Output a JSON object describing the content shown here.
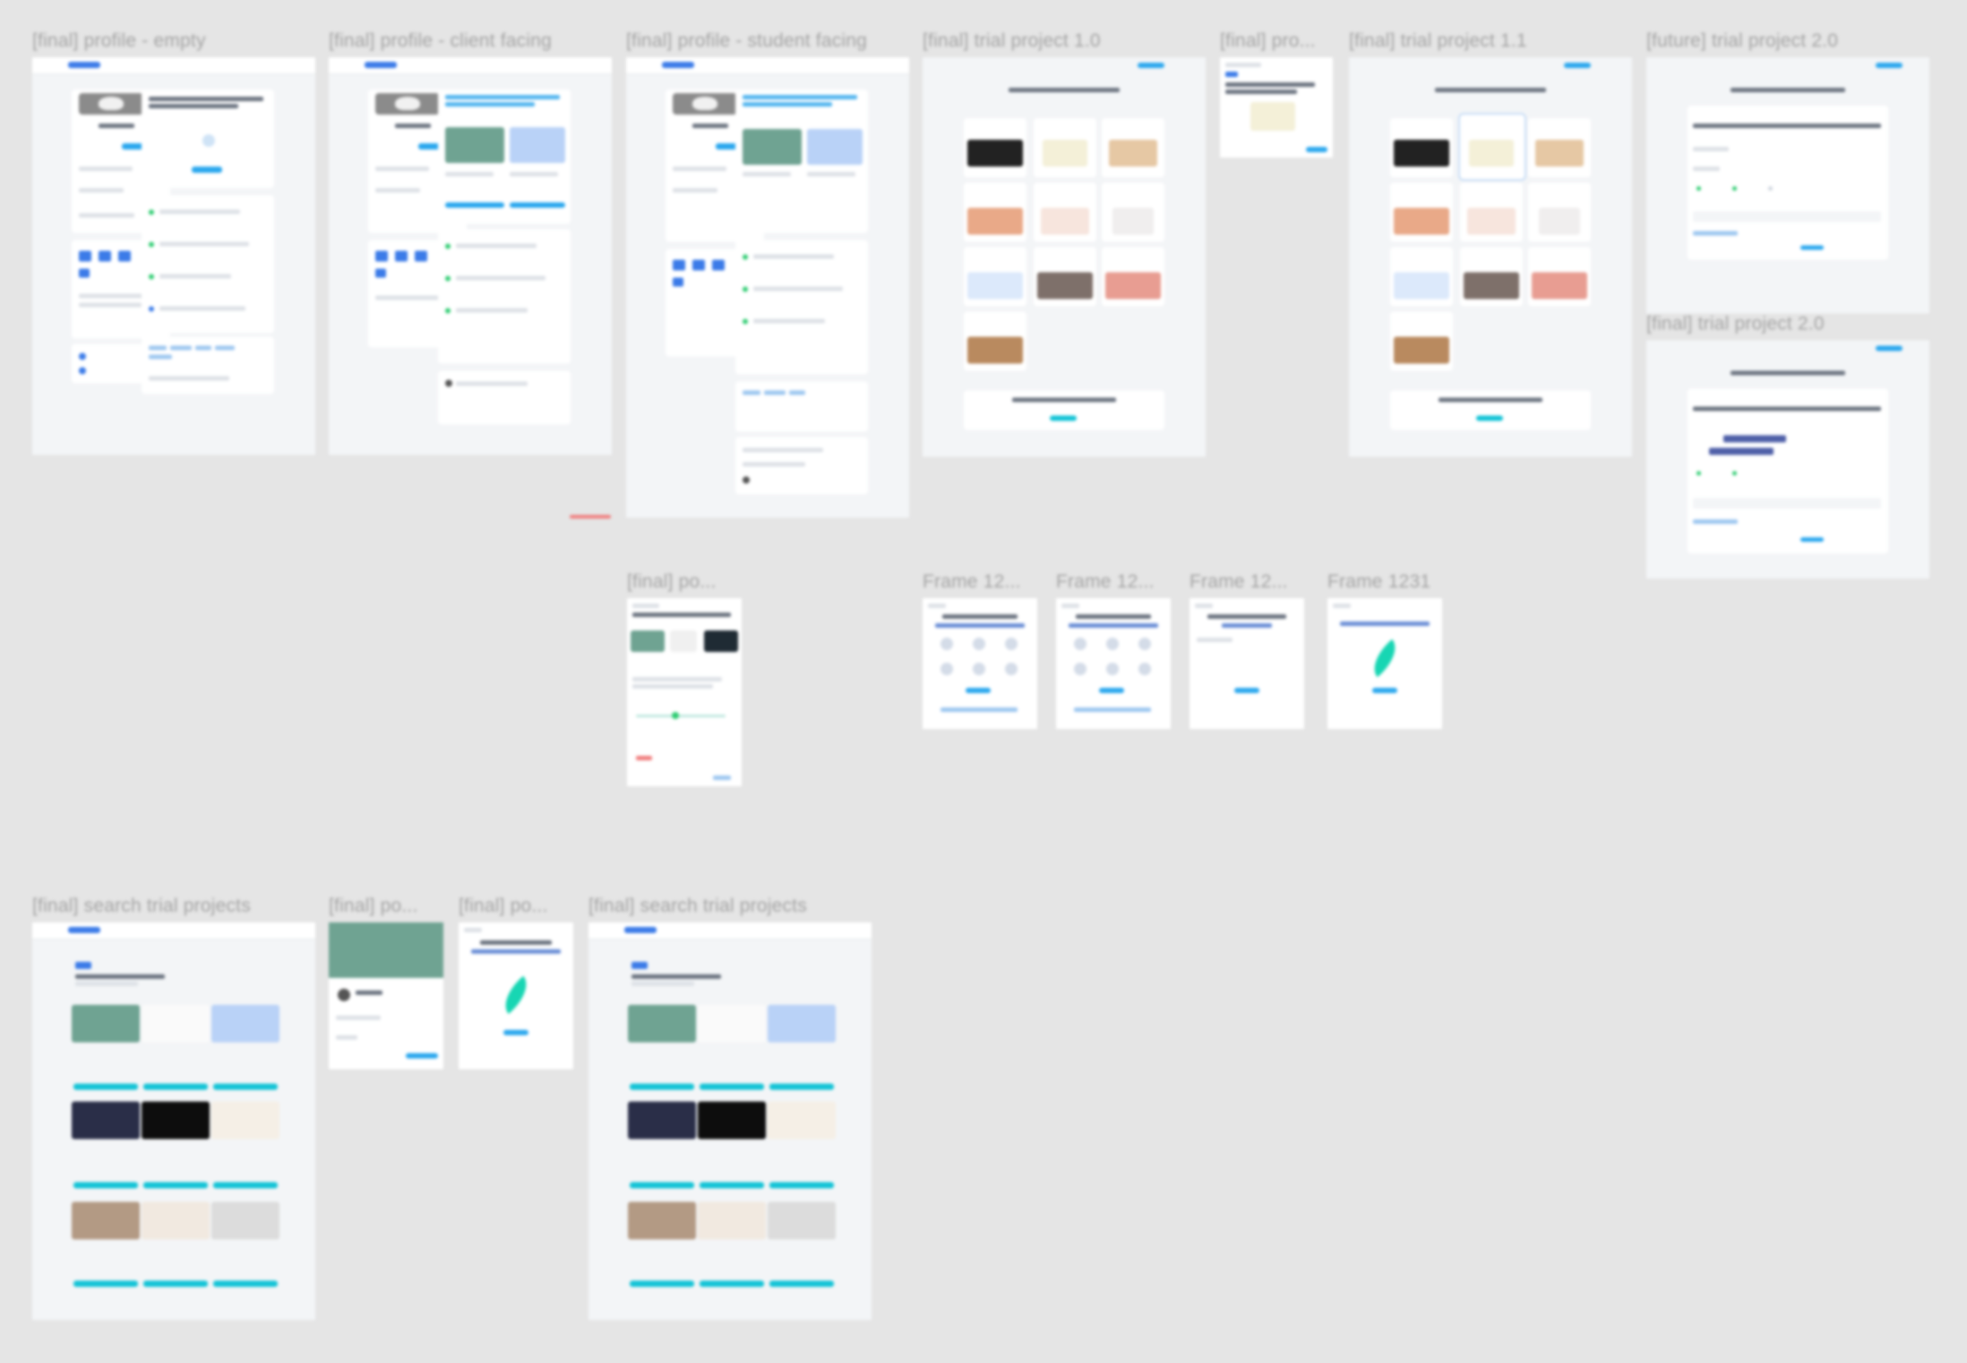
{
  "canvas": {
    "background": "#e5e5e5",
    "accent_color": "#2aa7ee",
    "cta_color": "#12c3d6",
    "frame_title_color": "#a3a3a3"
  },
  "frames": {
    "profile_empty": {
      "title": "[final] profile - empty"
    },
    "profile_client": {
      "title": "[final] profile - client facing"
    },
    "profile_student": {
      "title": "[final] profile - student facing"
    },
    "trial_project_1_0": {
      "title": "[final] trial project 1.0"
    },
    "pro_small": {
      "title": "[final] pro..."
    },
    "trial_project_1_1": {
      "title": "[final] trial project 1.1"
    },
    "future_trial_2_0": {
      "title": "[future] trial project 2.0"
    },
    "trial_2_0": {
      "title": "[final] trial project 2.0"
    },
    "po_mid": {
      "title": "[final] po..."
    },
    "frame_a": {
      "title": "Frame 12..."
    },
    "frame_b": {
      "title": "Frame 12..."
    },
    "frame_c": {
      "title": "Frame 12..."
    },
    "frame_1231": {
      "title": "Frame 1231"
    },
    "search_1": {
      "title": "[final] search trial projects"
    },
    "po_b1": {
      "title": "[final] po..."
    },
    "po_b2": {
      "title": "[final] po..."
    },
    "search_2": {
      "title": "[final] search trial projects"
    }
  }
}
